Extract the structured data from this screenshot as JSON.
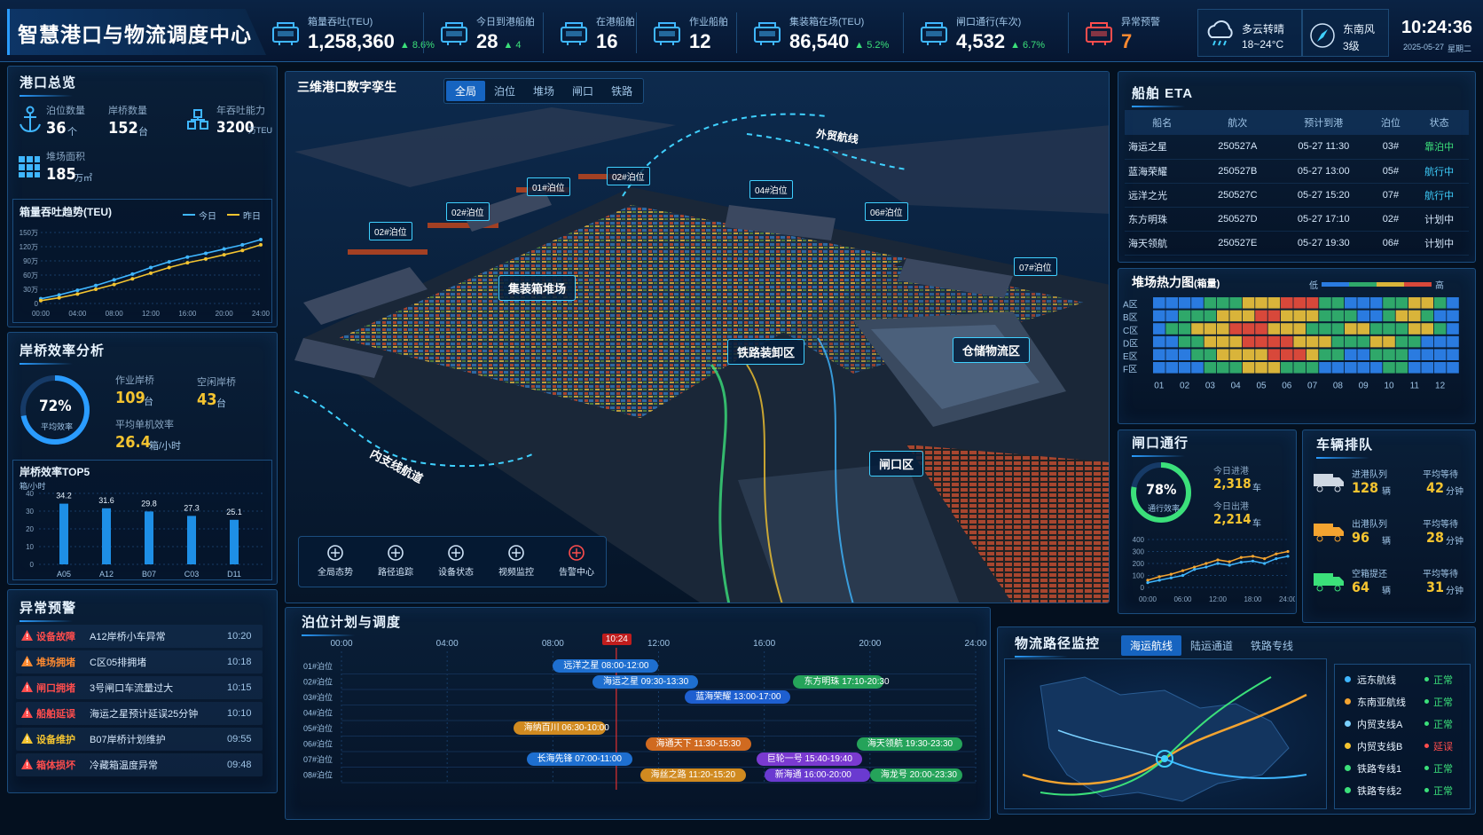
{
  "header": {
    "title": "智慧港口与物流调度中心"
  },
  "kpis": [
    {
      "label": "箱量吞吐(TEU)",
      "value": "1,258,360",
      "change": "▲ 8.6%",
      "unit": ""
    },
    {
      "label": "今日到港船舶",
      "value": "28",
      "change": "▲ 4",
      "unit": ""
    },
    {
      "label": "在港船舶",
      "value": "16",
      "change": "",
      "unit": ""
    },
    {
      "label": "作业船舶",
      "value": "12",
      "change": "",
      "unit": ""
    },
    {
      "label": "集装箱在场(TEU)",
      "value": "86,540",
      "change": "▲ 5.2%",
      "unit": ""
    },
    {
      "label": "闸口通行(车次)",
      "value": "4,532",
      "change": "▲ 6.7%",
      "unit": ""
    },
    {
      "label": "异常预警",
      "value": "7",
      "change": "",
      "unit": ""
    }
  ],
  "weather": {
    "desc": "多云转晴",
    "temp": "18~24°C",
    "wind": "东南风",
    "level": "3级"
  },
  "clock": {
    "time": "10:24:36",
    "date": "2025-05-27",
    "weekday": "星期二"
  },
  "overview": {
    "title": "港口总览",
    "items": [
      {
        "label": "泊位数量",
        "value": "36",
        "unit": "个"
      },
      {
        "label": "岸桥数量",
        "value": "152",
        "unit": "台"
      },
      {
        "label": "年吞吐能力",
        "value": "3200",
        "unit": "万TEU"
      },
      {
        "label": "堆场面积",
        "value": "185",
        "unit": "万㎡"
      }
    ],
    "trend": {
      "title": "箱量吞吐趋势(TEU)",
      "legend_today": "今日",
      "legend_yesterday": "昨日",
      "yticks": [
        "150万",
        "120万",
        "90万",
        "60万",
        "30万",
        "0"
      ],
      "xticks": [
        "00:00",
        "04:00",
        "08:00",
        "12:00",
        "16:00",
        "20:00",
        "24:00"
      ]
    }
  },
  "chart_data": [
    {
      "type": "line",
      "title": "箱量吞吐趋势(TEU)",
      "x": [
        "00:00",
        "02:00",
        "04:00",
        "06:00",
        "08:00",
        "10:00",
        "12:00",
        "14:00",
        "16:00",
        "18:00",
        "20:00",
        "22:00",
        "24:00"
      ],
      "series": [
        {
          "name": "今日",
          "values": [
            10,
            18,
            28,
            38,
            50,
            62,
            76,
            88,
            98,
            106,
            115,
            124,
            135
          ],
          "color": "#3fb6ff"
        },
        {
          "name": "昨日",
          "values": [
            6,
            12,
            20,
            30,
            40,
            52,
            64,
            76,
            86,
            94,
            103,
            112,
            124
          ],
          "color": "#f4c430"
        }
      ],
      "ylim": [
        0,
        150
      ],
      "ylabel": "万"
    },
    {
      "type": "bar",
      "title": "岸桥效率TOP5",
      "categories": [
        "A05",
        "A12",
        "B07",
        "C03",
        "D11"
      ],
      "values": [
        34.2,
        31.6,
        29.8,
        27.3,
        25.1
      ],
      "ylabel": "箱/小时",
      "ylim": [
        0,
        40
      ]
    },
    {
      "type": "line",
      "title": "闸口通行",
      "x": [
        "00:00",
        "02:00",
        "04:00",
        "06:00",
        "08:00",
        "10:00",
        "12:00",
        "14:00",
        "16:00",
        "18:00",
        "20:00",
        "22:00",
        "24:00"
      ],
      "series": [
        {
          "name": "进港",
          "values": [
            60,
            90,
            110,
            140,
            170,
            200,
            230,
            215,
            250,
            260,
            240,
            280,
            300
          ],
          "color": "#f4a430"
        },
        {
          "name": "出港",
          "values": [
            40,
            60,
            80,
            100,
            150,
            170,
            200,
            185,
            210,
            220,
            200,
            240,
            260
          ],
          "color": "#3fb6ff"
        }
      ],
      "ylim": [
        0,
        400
      ]
    },
    {
      "type": "heatmap",
      "title": "堆场热力图(箱量)",
      "rows": [
        "A区",
        "B区",
        "C区",
        "D区",
        "E区",
        "F区"
      ],
      "cols": [
        "01",
        "02",
        "03",
        "04",
        "05",
        "06",
        "07",
        "08",
        "09",
        "10",
        "11",
        "12"
      ],
      "values": [
        [
          1,
          1,
          1,
          1,
          2,
          2,
          2,
          3,
          3,
          3,
          4,
          4,
          4,
          2,
          2,
          1,
          1,
          1,
          2,
          2,
          3,
          3,
          2,
          1
        ],
        [
          1,
          1,
          2,
          2,
          2,
          3,
          3,
          3,
          4,
          4,
          3,
          3,
          3,
          2,
          2,
          2,
          1,
          1,
          2,
          3,
          3,
          2,
          1,
          1
        ],
        [
          1,
          2,
          2,
          3,
          3,
          3,
          4,
          4,
          4,
          3,
          3,
          3,
          2,
          2,
          2,
          3,
          3,
          2,
          2,
          2,
          3,
          3,
          2,
          1
        ],
        [
          1,
          1,
          2,
          2,
          3,
          3,
          3,
          4,
          4,
          4,
          4,
          3,
          3,
          3,
          2,
          2,
          2,
          3,
          3,
          2,
          2,
          1,
          1,
          1
        ],
        [
          1,
          1,
          1,
          2,
          2,
          3,
          3,
          3,
          3,
          4,
          4,
          4,
          3,
          2,
          2,
          1,
          1,
          2,
          2,
          2,
          1,
          1,
          1,
          1
        ],
        [
          1,
          1,
          1,
          1,
          2,
          2,
          2,
          3,
          3,
          3,
          2,
          2,
          2,
          1,
          1,
          1,
          1,
          1,
          2,
          2,
          1,
          1,
          1,
          1
        ]
      ]
    }
  ],
  "crane": {
    "title": "岸桥效率分析",
    "rate": "72%",
    "rate_value": 0.72,
    "rate_label": "平均效率",
    "working_label": "作业岸桥",
    "working": "109",
    "working_unit": "台",
    "idle_label": "空闲岸桥",
    "idle": "43",
    "idle_unit": "台",
    "avg_label": "平均单机效率",
    "avg": "26.4",
    "avg_unit": "箱/小时",
    "top5": {
      "title": "岸桥效率TOP5",
      "unit": "箱/小时",
      "yticks": [
        "40",
        "30",
        "20",
        "10",
        "0"
      ],
      "bars": [
        {
          "name": "A05",
          "value": "34.2"
        },
        {
          "name": "A12",
          "value": "31.6"
        },
        {
          "name": "B07",
          "value": "29.8"
        },
        {
          "name": "C03",
          "value": "27.3"
        },
        {
          "name": "D11",
          "value": "25.1"
        }
      ]
    }
  },
  "alarms": {
    "title": "异常预警",
    "items": [
      {
        "type": "设备故障",
        "text": "A12岸桥小车异常",
        "time": "10:20",
        "color": "#ff4d4d"
      },
      {
        "type": "堆场拥堵",
        "text": "C区05排拥堵",
        "time": "10:18",
        "color": "#ff8a30"
      },
      {
        "type": "闸口拥堵",
        "text": "3号闸口车流量过大",
        "time": "10:15",
        "color": "#ff4d4d"
      },
      {
        "type": "船舶延误",
        "text": "海运之星预计延误25分钟",
        "time": "10:10",
        "color": "#ff4d4d"
      },
      {
        "type": "设备维护",
        "text": "B07岸桥计划维护",
        "time": "09:55",
        "color": "#f4c430"
      },
      {
        "type": "箱体损坏",
        "text": "冷藏箱温度异常",
        "time": "09:48",
        "color": "#ff4d4d"
      }
    ]
  },
  "twin": {
    "title": "三维港口数字孪生",
    "tabs": [
      "全局",
      "泊位",
      "堆场",
      "闸口",
      "铁路"
    ],
    "labels": [
      "01#泊位",
      "02#泊位",
      "02#泊位",
      "02#泊位",
      "04#泊位",
      "06#泊位",
      "07#泊位"
    ],
    "zones": [
      "集装箱堆场",
      "铁路装卸区",
      "仓储物流区",
      "闸口区"
    ],
    "routes": [
      "外贸航线",
      "内支线航道"
    ],
    "tools": [
      {
        "label": "全局态势",
        "icon": "layers-icon"
      },
      {
        "label": "路径追踪",
        "icon": "route-icon"
      },
      {
        "label": "设备状态",
        "icon": "device-icon"
      },
      {
        "label": "视频监控",
        "icon": "camera-icon"
      },
      {
        "label": "告警中心",
        "icon": "alarm-icon"
      }
    ]
  },
  "eta": {
    "title": "船舶 ETA",
    "headers": [
      "船名",
      "航次",
      "预计到港",
      "泊位",
      "状态"
    ],
    "rows": [
      {
        "name": "海运之星",
        "voyage": "250527A",
        "eta": "05-27 11:30",
        "berth": "03#",
        "status": "靠泊中",
        "color": "#3be07a"
      },
      {
        "name": "蓝海荣耀",
        "voyage": "250527B",
        "eta": "05-27 13:00",
        "berth": "05#",
        "status": "航行中",
        "color": "#3fd0ff"
      },
      {
        "name": "远洋之光",
        "voyage": "250527C",
        "eta": "05-27 15:20",
        "berth": "07#",
        "status": "航行中",
        "color": "#3fd0ff"
      },
      {
        "name": "东方明珠",
        "voyage": "250527D",
        "eta": "05-27 17:10",
        "berth": "02#",
        "status": "计划中",
        "color": "#d6e8fb"
      },
      {
        "name": "海天领航",
        "voyage": "250527E",
        "eta": "05-27 19:30",
        "berth": "06#",
        "status": "计划中",
        "color": "#d6e8fb"
      }
    ]
  },
  "heatmap": {
    "title": "堆场热力图",
    "subtitle": "(箱量)",
    "low": "低",
    "high": "高",
    "rows": [
      "A区",
      "B区",
      "C区",
      "D区",
      "E区",
      "F区"
    ],
    "cols": [
      "01",
      "02",
      "03",
      "04",
      "05",
      "06",
      "07",
      "08",
      "09",
      "10",
      "11",
      "12"
    ]
  },
  "gate": {
    "title": "闸口通行",
    "rate": "78%",
    "rate_value": 0.78,
    "rate_label": "通行效率",
    "in_label": "今日进港",
    "in": "2,318",
    "in_unit": "车",
    "out_label": "今日出港",
    "out": "2,214",
    "out_unit": "车",
    "yticks": [
      "400",
      "300",
      "200",
      "100",
      "0"
    ],
    "xticks": [
      "00:00",
      "06:00",
      "12:00",
      "18:00",
      "24:00"
    ]
  },
  "queue": {
    "title": "车辆排队",
    "rows": [
      {
        "label": "进港队列",
        "value": "128",
        "unit": "辆",
        "wait_label": "平均等待",
        "wait": "42",
        "wait_unit": "分钟",
        "color": "#cfd8e3"
      },
      {
        "label": "出港队列",
        "value": "96",
        "unit": "辆",
        "wait_label": "平均等待",
        "wait": "28",
        "wait_unit": "分钟",
        "color": "#f4a430"
      },
      {
        "label": "空箱提还",
        "value": "64",
        "unit": "辆",
        "wait_label": "平均等待",
        "wait": "31",
        "wait_unit": "分钟",
        "color": "#3be07a"
      }
    ]
  },
  "berth_plan": {
    "title": "泊位计划与调度",
    "now": "10:24",
    "now_hour": 10.4,
    "hours": [
      "00:00",
      "04:00",
      "08:00",
      "12:00",
      "16:00",
      "20:00",
      "24:00"
    ],
    "rows": [
      "01#泊位",
      "02#泊位",
      "03#泊位",
      "04#泊位",
      "05#泊位",
      "06#泊位",
      "07#泊位",
      "08#泊位"
    ],
    "bars": [
      {
        "row": 0,
        "label": "远洋之星  08:00-12:00",
        "start": 8,
        "end": 12,
        "color": "#1e6fd0"
      },
      {
        "row": 1,
        "label": "东方明珠  17:10-20:30",
        "start": 17.1,
        "end": 20.5,
        "color": "#25a35a"
      },
      {
        "row": 1,
        "label": "海运之星  09:30-13:30",
        "start": 9.5,
        "end": 13.5,
        "color": "#1e6fd0"
      },
      {
        "row": 2,
        "label": "蓝海荣耀  13:00-17:00",
        "start": 13,
        "end": 17,
        "color": "#1e5fd0"
      },
      {
        "row": 4,
        "label": "海纳百川  06:30-10:00",
        "start": 6.5,
        "end": 10,
        "color": "#d08a20"
      },
      {
        "row": 5,
        "label": "海天领航  19:30-23:30",
        "start": 19.5,
        "end": 23.5,
        "color": "#25a35a"
      },
      {
        "row": 5,
        "label": "海通天下  11:30-15:30",
        "start": 11.5,
        "end": 15.5,
        "color": "#d06a20"
      },
      {
        "row": 6,
        "label": "巨轮一号  15:40-19:40",
        "start": 15.7,
        "end": 19.7,
        "color": "#7a3ad0"
      },
      {
        "row": 6,
        "label": "长海先锋  07:00-11:00",
        "start": 7,
        "end": 11,
        "color": "#1e6fd0"
      },
      {
        "row": 7,
        "label": "海丝之路  11:20-15:20",
        "start": 11.3,
        "end": 15.3,
        "color": "#d08a20"
      },
      {
        "row": 7,
        "label": "海龙号  20:00-23:30",
        "start": 20,
        "end": 23.5,
        "color": "#25a35a"
      },
      {
        "row": 8,
        "label": "新海通  16:00-20:00",
        "start": 16,
        "end": 20,
        "color": "#6a3ad0"
      }
    ]
  },
  "logistics": {
    "title": "物流路径监控",
    "tabs": [
      "海运航线",
      "陆运通道",
      "铁路专线"
    ],
    "routes": [
      {
        "name": "远东航线",
        "status": "正常",
        "dot": "#3fb6ff",
        "color": "#3be07a"
      },
      {
        "name": "东南亚航线",
        "status": "正常",
        "dot": "#f4a430",
        "color": "#3be07a"
      },
      {
        "name": "内贸支线A",
        "status": "正常",
        "dot": "#7ad0ff",
        "color": "#3be07a"
      },
      {
        "name": "内贸支线B",
        "status": "延误",
        "dot": "#f4c430",
        "color": "#ff4d4d"
      },
      {
        "name": "铁路专线1",
        "status": "正常",
        "dot": "#3be07a",
        "color": "#3be07a"
      },
      {
        "name": "铁路专线2",
        "status": "正常",
        "dot": "#3be07a",
        "color": "#3be07a"
      }
    ]
  }
}
